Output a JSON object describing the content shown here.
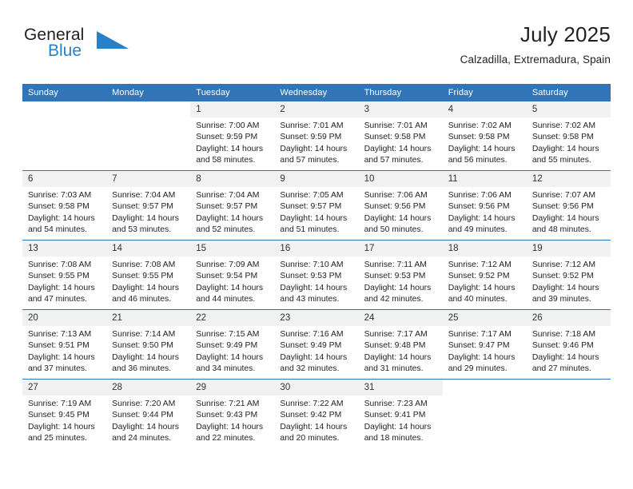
{
  "brand": {
    "name_part1": "General",
    "name_part2": "Blue",
    "triangle_color": "#2a7fc9"
  },
  "header": {
    "title": "July 2025",
    "subtitle": "Calzadilla, Extremadura, Spain"
  },
  "colors": {
    "header_blue": "#3175b8",
    "daynum_band": "#f1f1f1",
    "text": "#222222"
  },
  "weekday_headers": [
    "Sunday",
    "Monday",
    "Tuesday",
    "Wednesday",
    "Thursday",
    "Friday",
    "Saturday"
  ],
  "weeks": [
    [
      {
        "day": "",
        "blank": true
      },
      {
        "day": "",
        "blank": true
      },
      {
        "day": "1",
        "sunrise": "Sunrise: 7:00 AM",
        "sunset": "Sunset: 9:59 PM",
        "daylight_line1": "Daylight: 14 hours",
        "daylight_line2": "and 58 minutes."
      },
      {
        "day": "2",
        "sunrise": "Sunrise: 7:01 AM",
        "sunset": "Sunset: 9:59 PM",
        "daylight_line1": "Daylight: 14 hours",
        "daylight_line2": "and 57 minutes."
      },
      {
        "day": "3",
        "sunrise": "Sunrise: 7:01 AM",
        "sunset": "Sunset: 9:58 PM",
        "daylight_line1": "Daylight: 14 hours",
        "daylight_line2": "and 57 minutes."
      },
      {
        "day": "4",
        "sunrise": "Sunrise: 7:02 AM",
        "sunset": "Sunset: 9:58 PM",
        "daylight_line1": "Daylight: 14 hours",
        "daylight_line2": "and 56 minutes."
      },
      {
        "day": "5",
        "sunrise": "Sunrise: 7:02 AM",
        "sunset": "Sunset: 9:58 PM",
        "daylight_line1": "Daylight: 14 hours",
        "daylight_line2": "and 55 minutes."
      }
    ],
    [
      {
        "day": "6",
        "sunrise": "Sunrise: 7:03 AM",
        "sunset": "Sunset: 9:58 PM",
        "daylight_line1": "Daylight: 14 hours",
        "daylight_line2": "and 54 minutes."
      },
      {
        "day": "7",
        "sunrise": "Sunrise: 7:04 AM",
        "sunset": "Sunset: 9:57 PM",
        "daylight_line1": "Daylight: 14 hours",
        "daylight_line2": "and 53 minutes."
      },
      {
        "day": "8",
        "sunrise": "Sunrise: 7:04 AM",
        "sunset": "Sunset: 9:57 PM",
        "daylight_line1": "Daylight: 14 hours",
        "daylight_line2": "and 52 minutes."
      },
      {
        "day": "9",
        "sunrise": "Sunrise: 7:05 AM",
        "sunset": "Sunset: 9:57 PM",
        "daylight_line1": "Daylight: 14 hours",
        "daylight_line2": "and 51 minutes."
      },
      {
        "day": "10",
        "sunrise": "Sunrise: 7:06 AM",
        "sunset": "Sunset: 9:56 PM",
        "daylight_line1": "Daylight: 14 hours",
        "daylight_line2": "and 50 minutes."
      },
      {
        "day": "11",
        "sunrise": "Sunrise: 7:06 AM",
        "sunset": "Sunset: 9:56 PM",
        "daylight_line1": "Daylight: 14 hours",
        "daylight_line2": "and 49 minutes."
      },
      {
        "day": "12",
        "sunrise": "Sunrise: 7:07 AM",
        "sunset": "Sunset: 9:56 PM",
        "daylight_line1": "Daylight: 14 hours",
        "daylight_line2": "and 48 minutes."
      }
    ],
    [
      {
        "day": "13",
        "sunrise": "Sunrise: 7:08 AM",
        "sunset": "Sunset: 9:55 PM",
        "daylight_line1": "Daylight: 14 hours",
        "daylight_line2": "and 47 minutes."
      },
      {
        "day": "14",
        "sunrise": "Sunrise: 7:08 AM",
        "sunset": "Sunset: 9:55 PM",
        "daylight_line1": "Daylight: 14 hours",
        "daylight_line2": "and 46 minutes."
      },
      {
        "day": "15",
        "sunrise": "Sunrise: 7:09 AM",
        "sunset": "Sunset: 9:54 PM",
        "daylight_line1": "Daylight: 14 hours",
        "daylight_line2": "and 44 minutes."
      },
      {
        "day": "16",
        "sunrise": "Sunrise: 7:10 AM",
        "sunset": "Sunset: 9:53 PM",
        "daylight_line1": "Daylight: 14 hours",
        "daylight_line2": "and 43 minutes."
      },
      {
        "day": "17",
        "sunrise": "Sunrise: 7:11 AM",
        "sunset": "Sunset: 9:53 PM",
        "daylight_line1": "Daylight: 14 hours",
        "daylight_line2": "and 42 minutes."
      },
      {
        "day": "18",
        "sunrise": "Sunrise: 7:12 AM",
        "sunset": "Sunset: 9:52 PM",
        "daylight_line1": "Daylight: 14 hours",
        "daylight_line2": "and 40 minutes."
      },
      {
        "day": "19",
        "sunrise": "Sunrise: 7:12 AM",
        "sunset": "Sunset: 9:52 PM",
        "daylight_line1": "Daylight: 14 hours",
        "daylight_line2": "and 39 minutes."
      }
    ],
    [
      {
        "day": "20",
        "sunrise": "Sunrise: 7:13 AM",
        "sunset": "Sunset: 9:51 PM",
        "daylight_line1": "Daylight: 14 hours",
        "daylight_line2": "and 37 minutes."
      },
      {
        "day": "21",
        "sunrise": "Sunrise: 7:14 AM",
        "sunset": "Sunset: 9:50 PM",
        "daylight_line1": "Daylight: 14 hours",
        "daylight_line2": "and 36 minutes."
      },
      {
        "day": "22",
        "sunrise": "Sunrise: 7:15 AM",
        "sunset": "Sunset: 9:49 PM",
        "daylight_line1": "Daylight: 14 hours",
        "daylight_line2": "and 34 minutes."
      },
      {
        "day": "23",
        "sunrise": "Sunrise: 7:16 AM",
        "sunset": "Sunset: 9:49 PM",
        "daylight_line1": "Daylight: 14 hours",
        "daylight_line2": "and 32 minutes."
      },
      {
        "day": "24",
        "sunrise": "Sunrise: 7:17 AM",
        "sunset": "Sunset: 9:48 PM",
        "daylight_line1": "Daylight: 14 hours",
        "daylight_line2": "and 31 minutes."
      },
      {
        "day": "25",
        "sunrise": "Sunrise: 7:17 AM",
        "sunset": "Sunset: 9:47 PM",
        "daylight_line1": "Daylight: 14 hours",
        "daylight_line2": "and 29 minutes."
      },
      {
        "day": "26",
        "sunrise": "Sunrise: 7:18 AM",
        "sunset": "Sunset: 9:46 PM",
        "daylight_line1": "Daylight: 14 hours",
        "daylight_line2": "and 27 minutes."
      }
    ],
    [
      {
        "day": "27",
        "sunrise": "Sunrise: 7:19 AM",
        "sunset": "Sunset: 9:45 PM",
        "daylight_line1": "Daylight: 14 hours",
        "daylight_line2": "and 25 minutes."
      },
      {
        "day": "28",
        "sunrise": "Sunrise: 7:20 AM",
        "sunset": "Sunset: 9:44 PM",
        "daylight_line1": "Daylight: 14 hours",
        "daylight_line2": "and 24 minutes."
      },
      {
        "day": "29",
        "sunrise": "Sunrise: 7:21 AM",
        "sunset": "Sunset: 9:43 PM",
        "daylight_line1": "Daylight: 14 hours",
        "daylight_line2": "and 22 minutes."
      },
      {
        "day": "30",
        "sunrise": "Sunrise: 7:22 AM",
        "sunset": "Sunset: 9:42 PM",
        "daylight_line1": "Daylight: 14 hours",
        "daylight_line2": "and 20 minutes."
      },
      {
        "day": "31",
        "sunrise": "Sunrise: 7:23 AM",
        "sunset": "Sunset: 9:41 PM",
        "daylight_line1": "Daylight: 14 hours",
        "daylight_line2": "and 18 minutes."
      },
      {
        "day": "",
        "blank": true
      },
      {
        "day": "",
        "blank": true
      }
    ]
  ]
}
